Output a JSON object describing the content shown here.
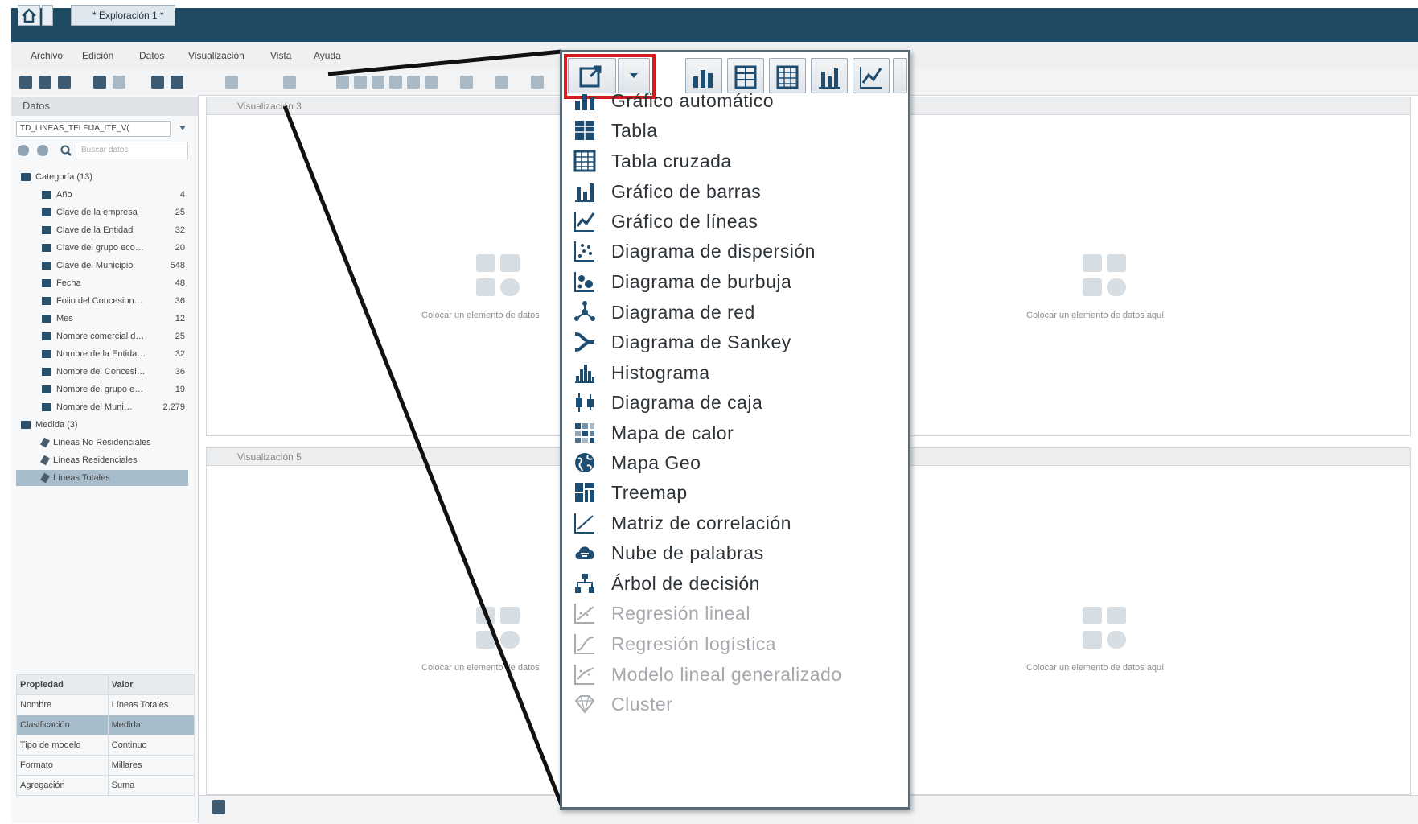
{
  "titlebar": {
    "tab_label": "* Exploración 1 *"
  },
  "menubar": {
    "items": [
      "Archivo",
      "Edición",
      "Datos",
      "Visualización",
      "Vista",
      "Ayuda"
    ]
  },
  "left_panel": {
    "header": "Datos",
    "source": "TD_LINEAS_TELFIJA_ITE_V(",
    "search_placeholder": "Buscar datos",
    "tree": [
      {
        "label": "Categoría (13)",
        "count": "",
        "kind": "group"
      },
      {
        "label": "Año",
        "count": "4",
        "kind": "item"
      },
      {
        "label": "Clave de la empresa",
        "count": "25",
        "kind": "item"
      },
      {
        "label": "Clave de la Entidad",
        "count": "32",
        "kind": "item"
      },
      {
        "label": "Clave del grupo eco…",
        "count": "20",
        "kind": "item"
      },
      {
        "label": "Clave del Municipio",
        "count": "548",
        "kind": "item"
      },
      {
        "label": "Fecha",
        "count": "48",
        "kind": "item"
      },
      {
        "label": "Folio del Concesion…",
        "count": "36",
        "kind": "item"
      },
      {
        "label": "Mes",
        "count": "12",
        "kind": "item"
      },
      {
        "label": "Nombre comercial d…",
        "count": "25",
        "kind": "item"
      },
      {
        "label": "Nombre de la Entida…",
        "count": "32",
        "kind": "item"
      },
      {
        "label": "Nombre del Concesi…",
        "count": "36",
        "kind": "item"
      },
      {
        "label": "Nombre del grupo e…",
        "count": "19",
        "kind": "item"
      },
      {
        "label": "Nombre del Muni…",
        "count": "2,279",
        "kind": "item"
      },
      {
        "label": "Medida (3)",
        "count": "",
        "kind": "group"
      },
      {
        "label": "Líneas No Residenciales",
        "count": "",
        "kind": "measure"
      },
      {
        "label": "Líneas Residenciales",
        "count": "",
        "kind": "measure"
      },
      {
        "label": "Líneas Totales",
        "count": "",
        "kind": "measure-selected"
      }
    ],
    "properties": {
      "headers": [
        "Propiedad",
        "Valor"
      ],
      "rows": [
        [
          "Nombre",
          "Líneas Totales"
        ],
        [
          "Clasificación",
          "Medida"
        ],
        [
          "Tipo de modelo",
          "Continuo"
        ],
        [
          "Formato",
          "Millares"
        ],
        [
          "Agregación",
          "Suma"
        ]
      ]
    }
  },
  "panes": {
    "top_left_title": "Visualización 3",
    "bottom_left_title": "Visualización 5",
    "placeholder_short": "Colocar un elemento de datos",
    "placeholder_full": "Colocar un elemento de datos aquí"
  },
  "dropdown": {
    "items": [
      {
        "label": "Gráfico automático",
        "icon": "auto-chart-icon",
        "enabled": true
      },
      {
        "label": "Tabla",
        "icon": "table-icon",
        "enabled": true
      },
      {
        "label": "Tabla cruzada",
        "icon": "crosstab-icon",
        "enabled": true
      },
      {
        "label": "Gráfico de barras",
        "icon": "bar-chart-icon",
        "enabled": true
      },
      {
        "label": "Gráfico de líneas",
        "icon": "line-chart-icon",
        "enabled": true
      },
      {
        "label": "Diagrama de dispersión",
        "icon": "scatter-icon",
        "enabled": true
      },
      {
        "label": "Diagrama de burbuja",
        "icon": "bubble-icon",
        "enabled": true
      },
      {
        "label": "Diagrama de red",
        "icon": "network-icon",
        "enabled": true
      },
      {
        "label": "Diagrama de Sankey",
        "icon": "sankey-icon",
        "enabled": true
      },
      {
        "label": "Histograma",
        "icon": "histogram-icon",
        "enabled": true
      },
      {
        "label": "Diagrama de caja",
        "icon": "box-plot-icon",
        "enabled": true
      },
      {
        "label": "Mapa de calor",
        "icon": "heatmap-icon",
        "enabled": true
      },
      {
        "label": "Mapa Geo",
        "icon": "geo-map-icon",
        "enabled": true
      },
      {
        "label": "Treemap",
        "icon": "treemap-icon",
        "enabled": true
      },
      {
        "label": "Matriz de correlación",
        "icon": "correlation-icon",
        "enabled": true
      },
      {
        "label": "Nube de palabras",
        "icon": "word-cloud-icon",
        "enabled": true
      },
      {
        "label": "Árbol de decisión",
        "icon": "decision-tree-icon",
        "enabled": true
      },
      {
        "label": "Regresión lineal",
        "icon": "linear-regression-icon",
        "enabled": false
      },
      {
        "label": "Regresión logística",
        "icon": "logistic-regression-icon",
        "enabled": false
      },
      {
        "label": "Modelo lineal generalizado",
        "icon": "glm-icon",
        "enabled": false
      },
      {
        "label": "Cluster",
        "icon": "cluster-icon",
        "enabled": false
      }
    ]
  },
  "colors": {
    "titlebar": "#1f4a63",
    "highlight_box": "#d31d1d",
    "icon_blue": "#1e4d72"
  }
}
